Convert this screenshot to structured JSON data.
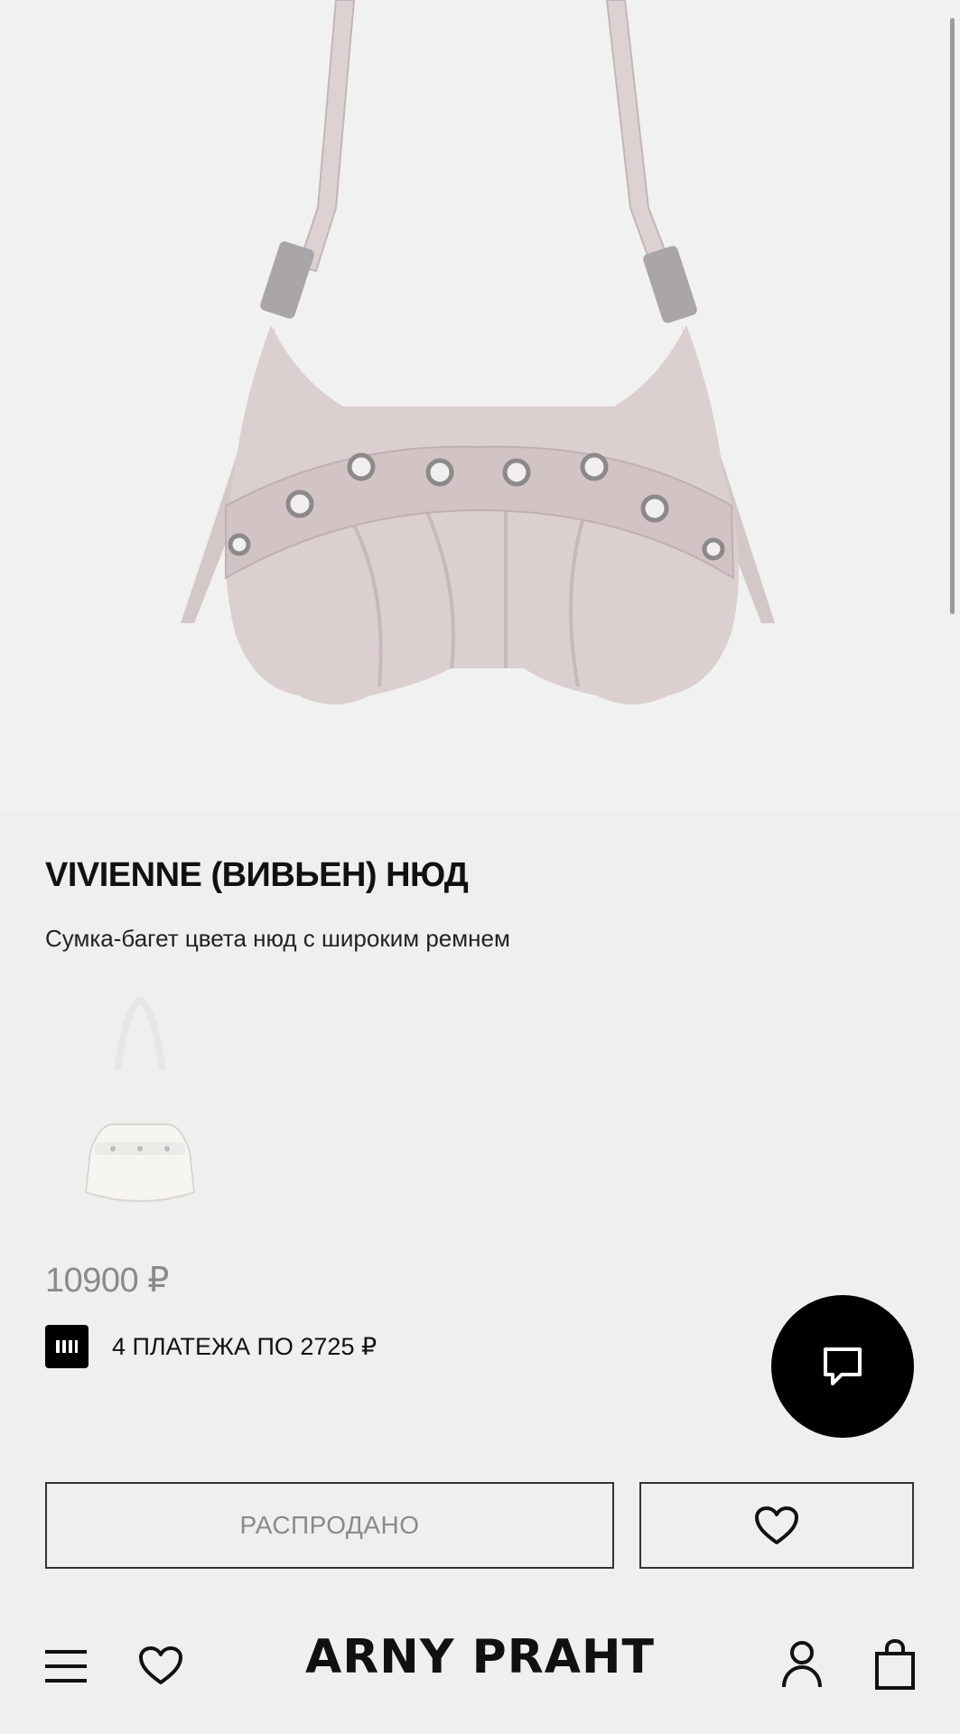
{
  "product": {
    "title": "VIVIENNE (ВИВЬЕН) НЮД",
    "description": "Сумка-багет цвета нюд с широким ремнем",
    "price": "10900 ₽",
    "installment": "4 ПЛАТЕЖА ПО 2725 ₽",
    "color": "#d9cdcd"
  },
  "actions": {
    "sold_out_label": "РАСПРОДАНО"
  },
  "nav": {
    "logo": "ARNY PRAHT",
    "left_icons": [
      "menu-icon",
      "heart-icon"
    ],
    "right_icons": [
      "user-icon",
      "bag-icon"
    ]
  },
  "colors": {
    "background": "#efefef",
    "accent": "#000000",
    "muted_text": "#8a8a8a"
  }
}
